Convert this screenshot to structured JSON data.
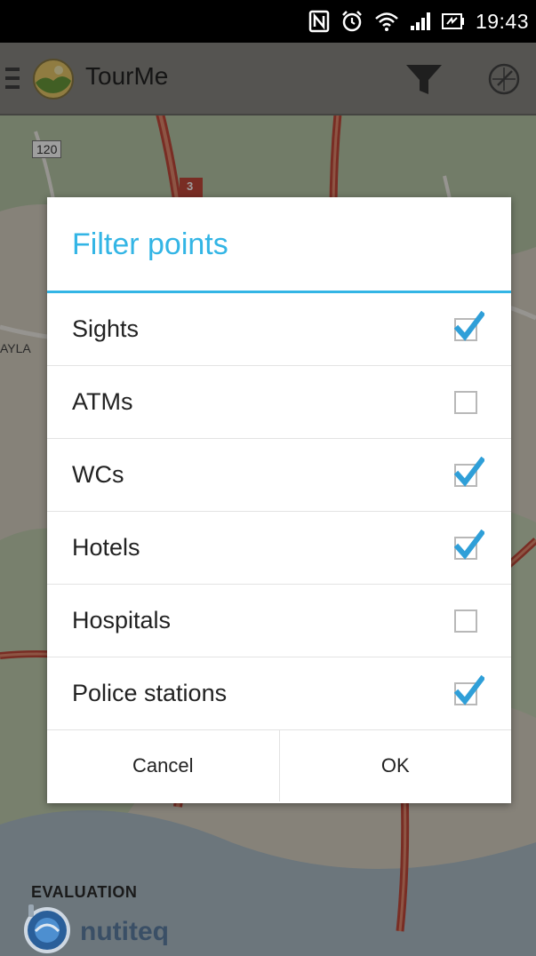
{
  "status_bar": {
    "time": "19:43",
    "icons": [
      "nfc-icon",
      "alarm-clock-icon",
      "wifi-icon",
      "signal-icon",
      "battery-icon"
    ]
  },
  "action_bar": {
    "title": "TourMe",
    "icons": [
      "hamburger-menu-icon",
      "app-logo-icon",
      "filter-funnel-icon",
      "compass-icon"
    ]
  },
  "map": {
    "labels": {
      "road_120": "120",
      "road_3": "3",
      "area_label": "AYLA"
    }
  },
  "dialog": {
    "title": "Filter points",
    "options": [
      {
        "label": "Sights",
        "checked": true
      },
      {
        "label": "ATMs",
        "checked": false
      },
      {
        "label": "WCs",
        "checked": true
      },
      {
        "label": "Hotels",
        "checked": true
      },
      {
        "label": "Hospitals",
        "checked": false
      },
      {
        "label": "Police stations",
        "checked": true
      }
    ],
    "buttons": {
      "cancel": "Cancel",
      "ok": "OK"
    }
  },
  "watermark": {
    "line1": "EVALUATION",
    "brand": "nutiteq"
  },
  "colors": {
    "accent": "#33b5e5",
    "check": "#2f9fd8"
  }
}
